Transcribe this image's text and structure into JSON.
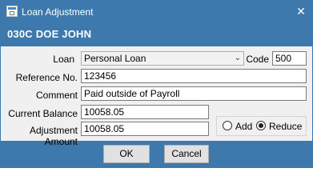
{
  "window": {
    "title": "Loan Adjustment",
    "close_label": "✕"
  },
  "header": {
    "name": "030C  DOE  JOHN"
  },
  "form": {
    "loan_label": "Loan",
    "loan_value": "Personal Loan",
    "code_label": "Code",
    "code_value": "500",
    "reference_label": "Reference No.",
    "reference_value": "123456",
    "comment_label": "Comment",
    "comment_value": "Paid outside of Payroll",
    "balance_label": "Current Balance",
    "balance_value": "10058.05",
    "adjustment_label": "Adjustment Amount",
    "adjustment_value": "10058.05",
    "options": [
      {
        "label": "Add",
        "selected": false
      },
      {
        "label": "Reduce",
        "selected": true
      }
    ]
  },
  "buttons": {
    "ok_label": "OK",
    "cancel_label": "Cancel"
  },
  "colors": {
    "frame": "#3d79ad",
    "panel": "#f0f0f0"
  },
  "icons": {
    "app": "app-window-icon",
    "close": "close-icon",
    "dropdown": "chevron-down-icon"
  }
}
